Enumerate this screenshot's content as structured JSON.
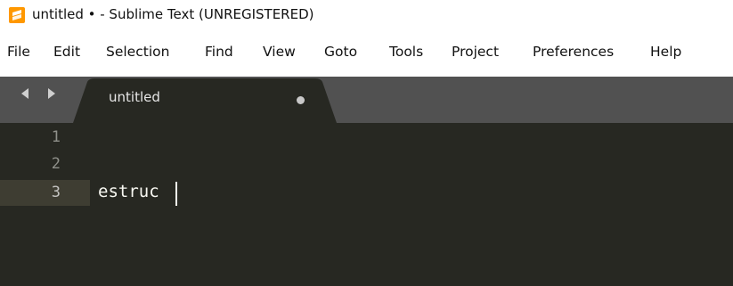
{
  "window": {
    "title": "untitled • - Sublime Text (UNREGISTERED)",
    "app_icon": "sublime-text-icon",
    "accent_color": "#ff9800"
  },
  "menu": {
    "items": [
      "File",
      "Edit",
      "Selection",
      "Find",
      "View",
      "Goto",
      "Tools",
      "Project",
      "Preferences",
      "Help"
    ]
  },
  "tabs": [
    {
      "label": "untitled",
      "modified": true,
      "active": true
    }
  ],
  "tab_nav_icons": [
    "arrow-left-icon",
    "arrow-right-icon"
  ],
  "editor": {
    "theme_background": "#272822",
    "lines": [
      {
        "number": "1",
        "text": ""
      },
      {
        "number": "2",
        "text": ""
      },
      {
        "number": "3",
        "text": "estruc"
      }
    ],
    "active_line": 3
  }
}
